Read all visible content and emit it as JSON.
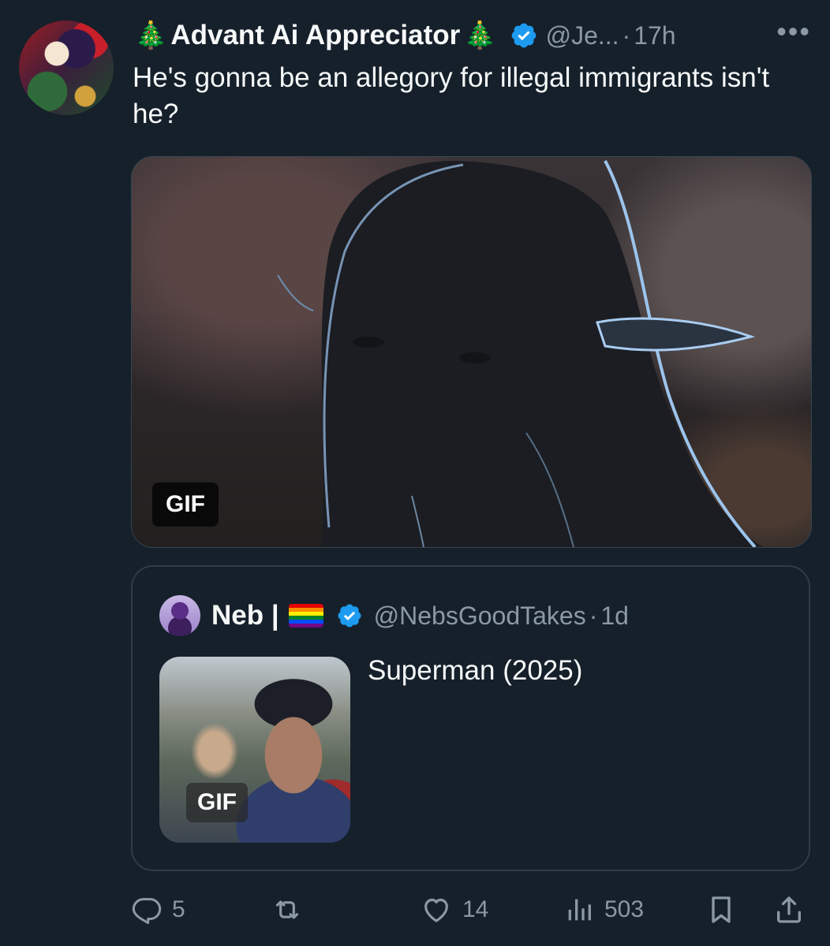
{
  "tweet": {
    "author": {
      "name_prefix_emoji": "🎄",
      "display_name": "Advant Ai Appreciator",
      "name_suffix_emoji": "🎄",
      "verified": true,
      "handle": "@Je...",
      "separator": "·",
      "time": "17h"
    },
    "more_label": "•••",
    "text": "He's gonna be an allegory for illegal immigrants isn't he?",
    "media": {
      "badge": "GIF"
    },
    "quote": {
      "author": {
        "display_name": "Neb |",
        "flag_emoji": "🏳️‍🌈",
        "verified": true,
        "handle": "@NebsGoodTakes",
        "separator": "·",
        "time": "1d"
      },
      "thumbnail_badge": "GIF",
      "text": "Superman (2025)"
    },
    "actions": {
      "replies": "5",
      "reposts": "",
      "likes": "14",
      "views": "503"
    }
  },
  "colors": {
    "background": "#15202b",
    "text_primary": "#f7f9f9",
    "text_secondary": "#8b98a5",
    "verified_blue": "#1d9bf0",
    "border": "#38444d"
  },
  "icons": {
    "reply": "reply-icon",
    "repost": "repost-icon",
    "like": "heart-icon",
    "views": "bar-chart-icon",
    "bookmark": "bookmark-icon",
    "share": "share-icon",
    "verified": "verified-badge-icon",
    "more": "more-icon"
  }
}
